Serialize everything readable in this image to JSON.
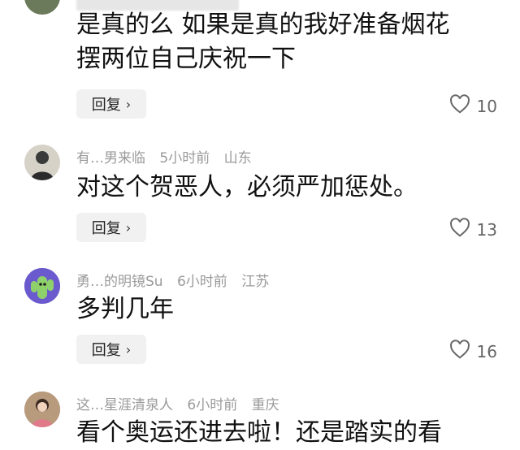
{
  "comments": [
    {
      "id": "c1",
      "text_lines": [
        "是真的么 如果是真的我好准备烟花",
        "摆两位自己庆祝一下"
      ],
      "reply_label": "回复",
      "like_count": "10"
    },
    {
      "id": "c2",
      "username": "有…男来临",
      "time": "5小时前",
      "location": "山东",
      "text_lines": [
        "对这个贺恶人，必须严加惩处。"
      ],
      "reply_label": "回复",
      "like_count": "13"
    },
    {
      "id": "c3",
      "username": "勇…的明镜Su",
      "time": "6小时前",
      "location": "江苏",
      "text_lines": [
        "多判几年"
      ],
      "reply_label": "回复",
      "like_count": "16"
    },
    {
      "id": "c4",
      "username": "这…星涯清泉人",
      "time": "6小时前",
      "location": "重庆",
      "text_lines": [
        "看个奥运还进去啦！还是踏实的看"
      ]
    }
  ],
  "colors": {
    "reply_bg": "#f1f1f1",
    "meta_text": "#9a9a9a",
    "like_text": "#666666"
  }
}
